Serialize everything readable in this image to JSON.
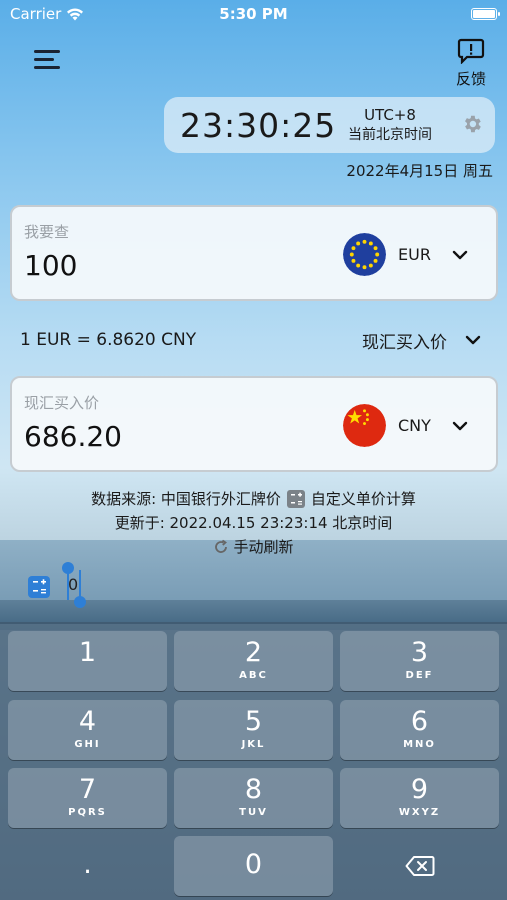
{
  "status_bar": {
    "carrier": "Carrier",
    "time": "5:30 PM"
  },
  "header": {
    "feedback_label": "反馈"
  },
  "clock": {
    "time": "23:30:25",
    "timezone": "UTC+8",
    "timezone_label": "当前北京时间",
    "date": "2022年4月15日 周五"
  },
  "from_card": {
    "label": "我要查",
    "value": "100",
    "currency": "EUR",
    "flag": "eu-flag"
  },
  "rate": {
    "text": "1 EUR = 6.8620 CNY",
    "type": "现汇买入价"
  },
  "to_card": {
    "label": "现汇买入价",
    "value": "686.20",
    "currency": "CNY",
    "flag": "china-flag"
  },
  "info": {
    "source": "数据来源: 中国银行外汇牌价",
    "custom": "自定义单价计算",
    "updated": "更新于: 2022.04.15 23:23:14 北京时间",
    "refresh": "手动刷新"
  },
  "mini_value": "0",
  "keyboard": {
    "keys": [
      {
        "digit": "1",
        "letters": ""
      },
      {
        "digit": "2",
        "letters": "ABC"
      },
      {
        "digit": "3",
        "letters": "DEF"
      },
      {
        "digit": "4",
        "letters": "GHI"
      },
      {
        "digit": "5",
        "letters": "JKL"
      },
      {
        "digit": "6",
        "letters": "MNO"
      },
      {
        "digit": "7",
        "letters": "PQRS"
      },
      {
        "digit": "8",
        "letters": "TUV"
      },
      {
        "digit": "9",
        "letters": "WXYZ"
      },
      {
        "digit": ".",
        "letters": ""
      },
      {
        "digit": "0",
        "letters": ""
      }
    ]
  },
  "colors": {
    "accent": "#1a2333",
    "eu_blue": "#1f3f9e",
    "cn_red": "#de2910"
  }
}
